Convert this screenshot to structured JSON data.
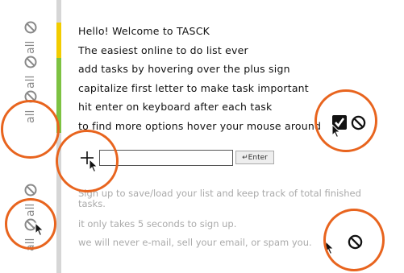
{
  "sidebar": {
    "items": [
      {
        "label": "all"
      },
      {
        "label": "all"
      },
      {
        "label": "all"
      },
      {
        "label": "all"
      },
      {
        "label": "all"
      }
    ],
    "icon": "ban-icon"
  },
  "intro": {
    "lines": [
      "Hello! Welcome to TASCK",
      "The easiest online to do list ever",
      "add tasks by hovering over the plus sign",
      "capitalize first letter to make task important",
      "hit enter on keyboard after each task",
      "to find more options hover your mouse around"
    ]
  },
  "add_task": {
    "input_value": "",
    "enter_label": "↵Enter"
  },
  "footer": {
    "signup_line1": "Sign up to save/load your list and keep track of total finished",
    "signup_line2": "tasks.",
    "quick": "it only takes 5 seconds to sign up.",
    "never": "we will never e-mail, sell your email, or spam you."
  },
  "colors": {
    "annotation": "#e8641e",
    "bar_yellow": "#f2cc00",
    "bar_green": "#7dc242",
    "muted_text": "#aaaaaa"
  }
}
